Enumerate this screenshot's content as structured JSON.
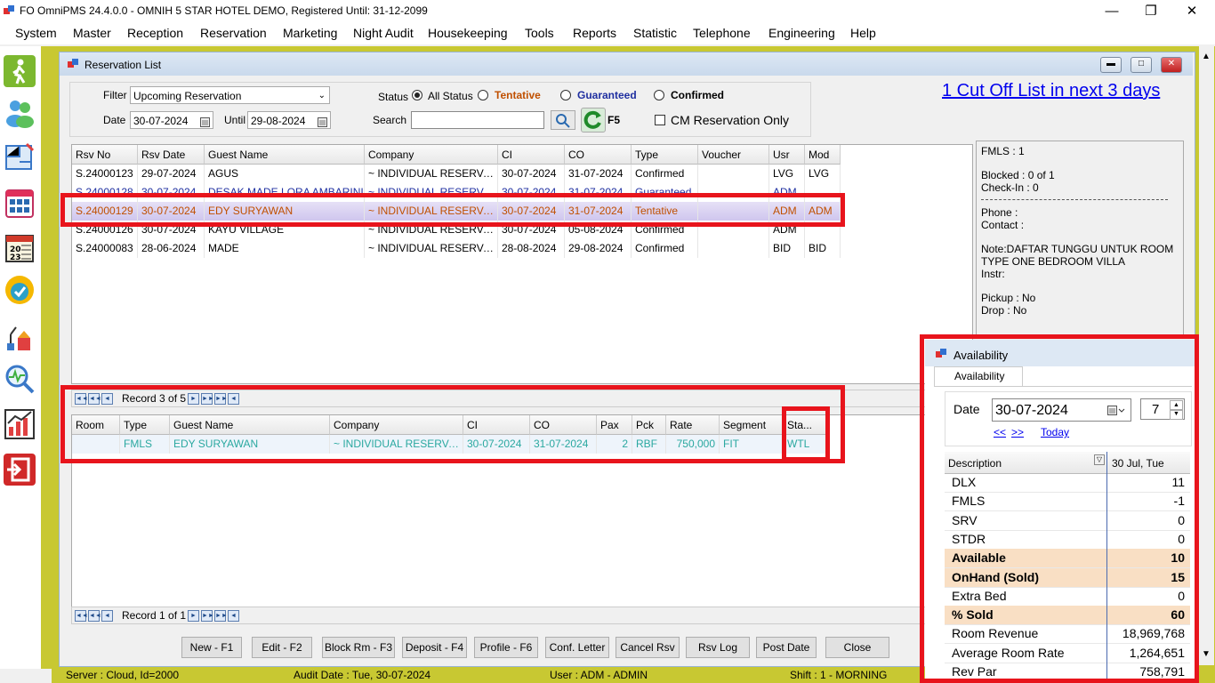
{
  "window": {
    "title": "FO OmniPMS 24.4.0.0 - OMNIH 5 STAR HOTEL DEMO, Registered Until: 31-12-2099"
  },
  "menu": [
    "System",
    "Master",
    "Reception",
    "Reservation",
    "Marketing",
    "Night Audit",
    "Housekeeping",
    "Tools",
    "Reports",
    "Statistic",
    "Telephone",
    "Engineering",
    "Help"
  ],
  "child": {
    "title": "Reservation List"
  },
  "filter": {
    "filter_label": "Filter",
    "filter_value": "Upcoming Reservation",
    "date_label": "Date",
    "date_value": "30-07-2024",
    "until_label": "Until",
    "until_value": "29-08-2024",
    "status_label": "Status",
    "all_status": "All Status",
    "tentative": "Tentative",
    "guaranteed": "Guaranteed",
    "confirmed": "Confirmed",
    "search_label": "Search",
    "search_value": "",
    "refresh_key": "F5",
    "cm_only": "CM Reservation Only"
  },
  "cutoff_link": "1 Cut Off List in next 3 days",
  "reservations": {
    "columns": [
      "Rsv No",
      "Rsv Date",
      "Guest Name",
      "Company",
      "CI",
      "CO",
      "Type",
      "Voucher",
      "Usr",
      "Mod"
    ],
    "rows": [
      [
        "S.24000123",
        "29-07-2024",
        "AGUS",
        "~ INDIVIDUAL RESERVATI...",
        "30-07-2024",
        "31-07-2024",
        "Confirmed",
        "",
        "LVG",
        "LVG"
      ],
      [
        "S.24000128",
        "30-07-2024",
        "DESAK MADE LORA AMBARINI",
        "~ INDIVIDUAL RESERVATI...",
        "30-07-2024",
        "31-07-2024",
        "Guaranteed",
        "",
        "ADM",
        ""
      ],
      [
        "S.24000129",
        "30-07-2024",
        "EDY SURYAWAN",
        "~ INDIVIDUAL RESERVATI...",
        "30-07-2024",
        "31-07-2024",
        "Tentative",
        "",
        "ADM",
        "ADM"
      ],
      [
        "S.24000126",
        "30-07-2024",
        "KAYU VILLAGE",
        "~ INDIVIDUAL RESERVATI...",
        "30-07-2024",
        "05-08-2024",
        "Confirmed",
        "",
        "ADM",
        ""
      ],
      [
        "S.24000083",
        "28-06-2024",
        "MADE",
        "~ INDIVIDUAL RESERVATI...",
        "28-08-2024",
        "29-08-2024",
        "Confirmed",
        "",
        "BID",
        "BID"
      ]
    ]
  },
  "nav1": {
    "record": "Record 3 of 5"
  },
  "rooms": {
    "columns": [
      "Room",
      "Type",
      "Guest Name",
      "Company",
      "CI",
      "CO",
      "Pax",
      "Pck",
      "Rate",
      "Segment",
      "Sta..."
    ],
    "rows": [
      [
        "",
        "FMLS",
        "EDY SURYAWAN",
        "~ INDIVIDUAL RESERVATI...",
        "30-07-2024",
        "31-07-2024",
        "2",
        "RBF",
        "750,000",
        "FIT",
        "WTL"
      ]
    ]
  },
  "nav2": {
    "record": "Record 1 of 1"
  },
  "info": {
    "line1": "FMLS : 1",
    "blocked": "Blocked : 0 of 1",
    "checkin": "Check-In : 0",
    "phone": "Phone :",
    "contact": "Contact :",
    "note1": "Note:DAFTAR TUNGGU UNTUK ROOM",
    "note2": "TYPE ONE BEDROOM VILLA",
    "instr": "Instr:",
    "pickup": "Pickup : No",
    "drop": "Drop : No"
  },
  "buttons": [
    "New - F1",
    "Edit - F2",
    "Block Rm - F3",
    "Deposit - F4",
    "Profile - F6",
    "Conf. Letter",
    "Cancel Rsv",
    "Rsv Log",
    "Post Date",
    "Close"
  ],
  "status": {
    "server": "Server : Cloud, Id=2000",
    "audit": "Audit Date : Tue, 30-07-2024",
    "user": "User : ADM - ADMIN",
    "shift": "Shift : 1 - MORNING"
  },
  "availability": {
    "title": "Availability",
    "tab": "Availability",
    "date_label": "Date",
    "date_value": "30-07-2024",
    "days_value": "7",
    "prev": "<<",
    "next": ">>",
    "today": "Today",
    "col_desc": "Description",
    "col_day": "30 Jul, Tue",
    "rows": [
      {
        "d": "DLX",
        "v": "11",
        "hl": false
      },
      {
        "d": "FMLS",
        "v": "-1",
        "hl": false
      },
      {
        "d": "SRV",
        "v": "0",
        "hl": false
      },
      {
        "d": "STDR",
        "v": "0",
        "hl": false
      },
      {
        "d": "Available",
        "v": "10",
        "hl": true
      },
      {
        "d": "OnHand (Sold)",
        "v": "15",
        "hl": true
      },
      {
        "d": "Extra Bed",
        "v": "0",
        "hl": false
      },
      {
        "d": "% Sold",
        "v": "60",
        "hl": true
      },
      {
        "d": "Room Revenue",
        "v": "18,969,768",
        "hl": false
      },
      {
        "d": "Average Room Rate",
        "v": "1,264,651",
        "hl": false
      },
      {
        "d": "Rev Par",
        "v": "758,791",
        "hl": false
      }
    ]
  },
  "colors": {
    "accent": "#c8c832",
    "highlight": "#e8141c",
    "tentative": "#c05000",
    "guaranteed": "#1f2fa0",
    "wtl": "#2aa8a0"
  }
}
